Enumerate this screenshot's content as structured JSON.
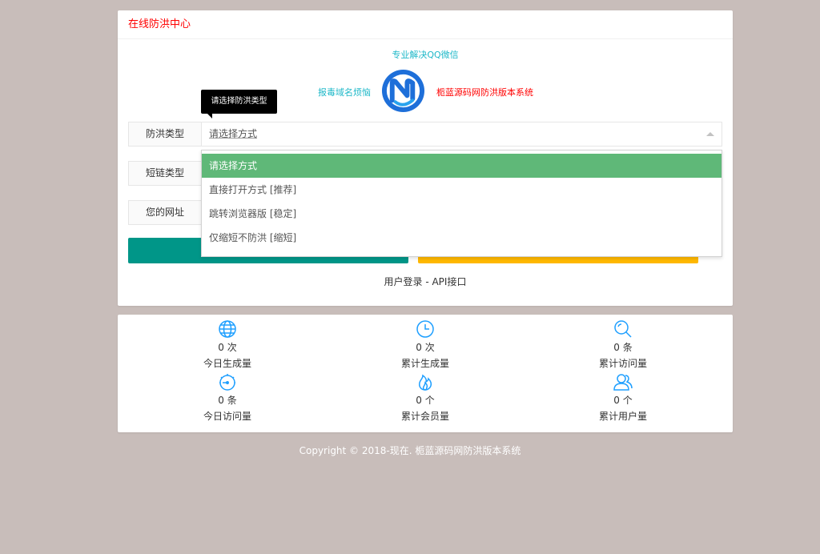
{
  "header": {
    "title": "在线防洪中心"
  },
  "promo": {
    "top": "专业解决QQ微信",
    "left": "报毒域名烦恼",
    "right": "栀蓝源码网防洪版本系统"
  },
  "tooltip": "请选择防洪类型",
  "form": {
    "fangHong": {
      "label": "防洪类型",
      "value": "请选择方式"
    },
    "duanLian": {
      "label": "短链类型"
    },
    "url": {
      "label": "您的网址"
    }
  },
  "dropdown": {
    "options": [
      "请选择方式",
      "直接打开方式 [推荐]",
      "跳转浏览器版 [稳定]",
      "仅缩短不防洪 [缩短]"
    ],
    "selected_index": 0
  },
  "links": {
    "text": "用户登录 - API接口"
  },
  "stats": [
    {
      "icon": "globe-icon",
      "value": "0 次",
      "label": "今日生成量"
    },
    {
      "icon": "clock-icon",
      "value": "0 次",
      "label": "累计生成量"
    },
    {
      "icon": "search-icon",
      "value": "0 条",
      "label": "累计访问量"
    },
    {
      "icon": "gauge-icon",
      "value": "0 条",
      "label": "今日访问量"
    },
    {
      "icon": "fire-icon",
      "value": "0 个",
      "label": "累计会员量"
    },
    {
      "icon": "users-icon",
      "value": "0 个",
      "label": "累计用户量"
    }
  ],
  "footer": {
    "text": "Copyright © 2018-现在. 栀蓝源码网防洪版本系统"
  },
  "colors": {
    "page_bg": "#c8bdba",
    "title_red": "#ff0000",
    "promo_cyan": "#1eb8c8",
    "teal_button": "#009688",
    "yellow_button": "#ffb800",
    "selected_green": "#5fb878",
    "icon_blue": "#1e9fff"
  }
}
